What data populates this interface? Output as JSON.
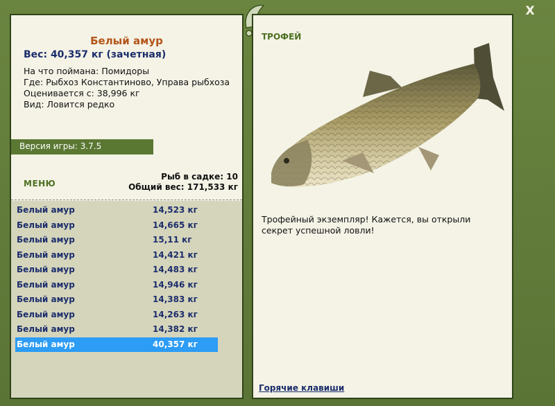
{
  "fish": {
    "title": "Белый амур",
    "weight": "Вес: 40,357 кг (зачетная)",
    "bait": "На что поймана: Помидоры",
    "place": "Где: Рыбхоз Константиново, Управа рыбхоза",
    "valued": "Оценивается с: 38,996 кг",
    "kind": "Вид: Ловится редко"
  },
  "version": "Версия игры: 3.7.5",
  "menu_label": "МЕНЮ",
  "cage": {
    "count": "Рыб в садке: 10",
    "total": "Общий вес: 171,533 кг"
  },
  "fish_list": [
    {
      "name": "Белый амур",
      "weight": "14,523 кг"
    },
    {
      "name": "Белый амур",
      "weight": "14,665 кг"
    },
    {
      "name": "Белый амур",
      "weight": "15,11 кг"
    },
    {
      "name": "Белый амур",
      "weight": "14,421 кг"
    },
    {
      "name": "Белый амур",
      "weight": "14,483 кг"
    },
    {
      "name": "Белый амур",
      "weight": "14,946 кг"
    },
    {
      "name": "Белый амур",
      "weight": "14,383 кг"
    },
    {
      "name": "Белый амур",
      "weight": "14,263 кг"
    },
    {
      "name": "Белый амур",
      "weight": "14,382 кг"
    },
    {
      "name": "Белый амур",
      "weight": "40,357 кг"
    }
  ],
  "selected_index": 9,
  "trophy": {
    "label": "ТРОФЕЙ",
    "text": "Трофейный экземпляр! Кажется, вы открыли секрет успешной ловли!"
  },
  "hotkeys": "Горячие клавиши",
  "close_label": "X",
  "colors": {
    "frame": "#5f7a3a",
    "panel": "#f4f3e6",
    "title": "#b5551a",
    "link": "#1b2d6b",
    "selected": "#2c9cf5",
    "list_bg": "#d5d5bc"
  }
}
